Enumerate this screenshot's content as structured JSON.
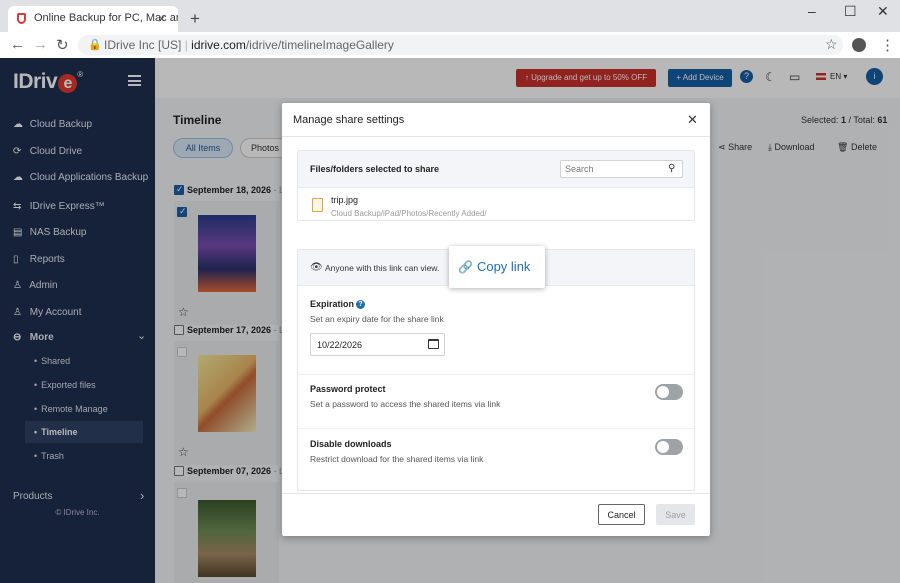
{
  "browser": {
    "tab_title": "Online Backup for PC, Mac and iPhone",
    "tab_close": "×",
    "new_tab": "+",
    "minimize": "–",
    "maximize": "☐",
    "close": "✕",
    "site_identity": "IDrive Inc [US]",
    "url_host": "idrive.com",
    "url_path": "/idrive/timelineImageGallery"
  },
  "sidebar": {
    "logo_text": "IDriv",
    "logo_e": "e",
    "logo_reg": "®",
    "items": [
      {
        "icon": "☁",
        "label": "Cloud Backup"
      },
      {
        "icon": "⟳",
        "label": "Cloud Drive"
      },
      {
        "icon": "☁",
        "label": "Cloud Applications Backup"
      },
      {
        "icon": "⇆",
        "label": "IDrive Express™"
      },
      {
        "icon": "▤",
        "label": "NAS Backup"
      },
      {
        "icon": "▯",
        "label": "Reports"
      },
      {
        "icon": "♙",
        "label": "Admin"
      },
      {
        "icon": "♙",
        "label": "My Account"
      },
      {
        "icon": "⊖",
        "label": "More"
      }
    ],
    "more_chevron": "⌄",
    "sub_items": [
      "Shared",
      "Exported files",
      "Remote Manage",
      "Timeline",
      "Trash"
    ],
    "products_label": "Products",
    "products_chevron": "›",
    "copyright": "© IDrive Inc."
  },
  "topbar": {
    "upgrade_label": "↑ Upgrade and get up to 50% OFF",
    "add_device_label": "+ Add Device",
    "help": "?",
    "lang": "EN ▾",
    "avatar": "i"
  },
  "page": {
    "title": "Timeline",
    "filter_all": "All Items",
    "filter_photos": "Photos",
    "selected_label": "Selected: ",
    "selected_count": "1",
    "total_label": " / Total: ",
    "total_count": "61",
    "share_label": "Share",
    "download_label": "Download",
    "delete_label": "Delete",
    "groups": [
      {
        "date": "September 18, 2026",
        "rest": " - Lo",
        "checked": true
      },
      {
        "date": "September 17, 2026",
        "rest": " - Lo",
        "checked": false
      },
      {
        "date": "September 07, 2026",
        "rest": " - Lo",
        "checked": false
      }
    ]
  },
  "modal": {
    "title": "Manage share settings",
    "close": "✕",
    "files_header": "Files/folders selected to share",
    "search_placeholder": "Search",
    "file_name": "trip.jpg",
    "file_path": "Cloud Backup/iPad/Photos/Recently Added/",
    "anyone_text": "Anyone with this link can view.",
    "copy_link": "Copy link",
    "expiration_title": "Expiration",
    "expiration_help": "?",
    "expiration_desc": "Set an expiry date for the share link",
    "expiration_date": "10/22/2026",
    "password_title": "Password protect",
    "password_desc": "Set a password to access the shared items via link",
    "password_enabled": false,
    "downloads_title": "Disable downloads",
    "downloads_desc": "Restrict download for the shared items via link",
    "downloads_enabled": false,
    "cancel_label": "Cancel",
    "save_label": "Save"
  }
}
